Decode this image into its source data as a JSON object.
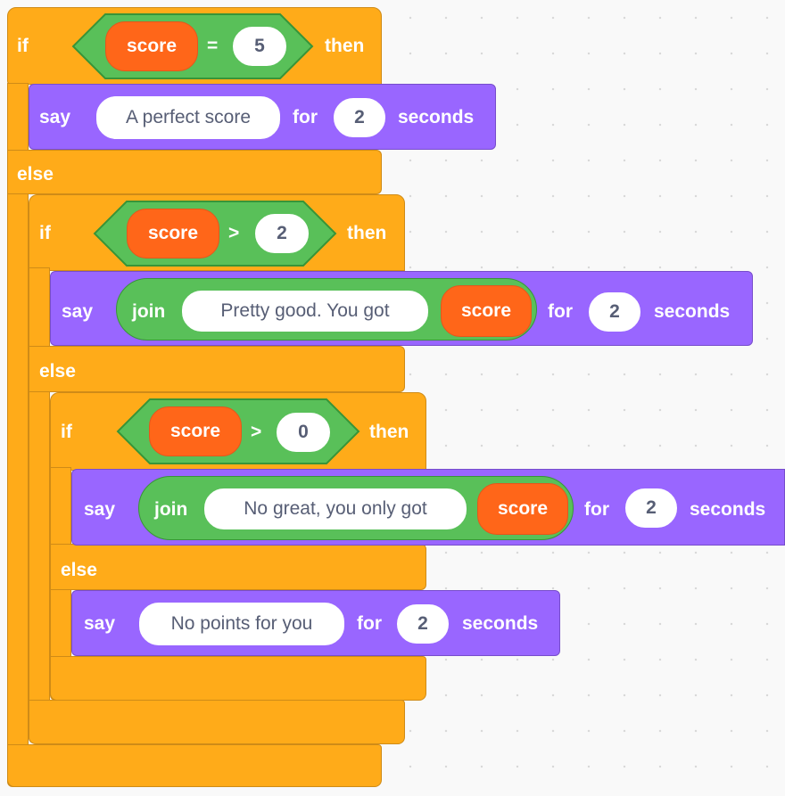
{
  "blocks": {
    "outer": {
      "if_label": "if",
      "then_label": "then",
      "else_label": "else",
      "condition": {
        "variable": "score",
        "operator": "=",
        "value": "5"
      },
      "say": {
        "say_label": "say",
        "message": "A perfect score",
        "for_label": "for",
        "seconds": "2",
        "seconds_label": "seconds"
      }
    },
    "middle": {
      "if_label": "if",
      "then_label": "then",
      "else_label": "else",
      "condition": {
        "variable": "score",
        "operator": ">",
        "value": "2"
      },
      "say": {
        "say_label": "say",
        "join_label": "join",
        "text": "Pretty good. You got",
        "variable": "score",
        "for_label": "for",
        "seconds": "2",
        "seconds_label": "seconds"
      }
    },
    "inner": {
      "if_label": "if",
      "then_label": "then",
      "else_label": "else",
      "condition": {
        "variable": "score",
        "operator": ">",
        "value": "0"
      },
      "say": {
        "say_label": "say",
        "join_label": "join",
        "text": "No great, you only got",
        "variable": "score",
        "for_label": "for",
        "seconds": "2",
        "seconds_label": "seconds"
      },
      "else_say": {
        "say_label": "say",
        "message": "No points for you",
        "for_label": "for",
        "seconds": "2",
        "seconds_label": "seconds"
      }
    }
  },
  "colors": {
    "control": "#ffab19",
    "looks": "#9966ff",
    "operators": "#59c059",
    "variables": "#ff6619",
    "canvas": "#f9f9f9"
  }
}
